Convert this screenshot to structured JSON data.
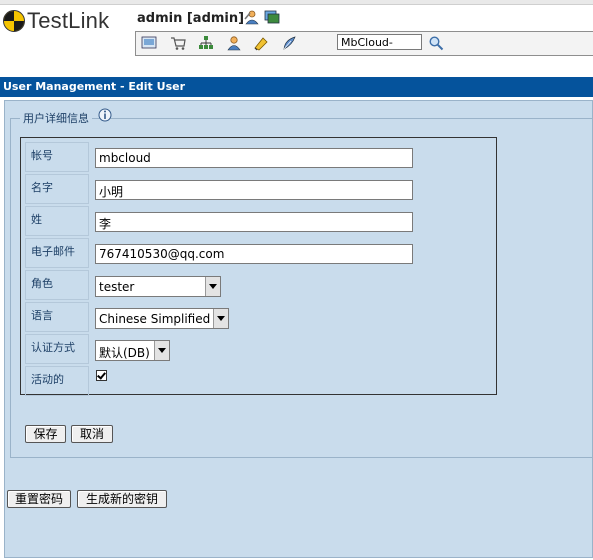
{
  "app": {
    "logo_text": "TestLink",
    "user": "admin [admin]"
  },
  "toolbar": {
    "project_select": "MbCloud-"
  },
  "title_bar": "User Management - Edit User",
  "form": {
    "legend": "用户详细信息",
    "fields": {
      "login": {
        "label": "帐号",
        "value": "mbcloud"
      },
      "first_name": {
        "label": "名字",
        "value": "小明"
      },
      "last_name": {
        "label": "姓",
        "value": "李"
      },
      "email": {
        "label": "电子邮件",
        "value": "767410530@qq.com"
      },
      "role": {
        "label": "角色",
        "value": "tester"
      },
      "locale": {
        "label": "语言",
        "value": "Chinese Simplified"
      },
      "auth": {
        "label": "认证方式",
        "value": "默认(DB)"
      },
      "active": {
        "label": "活动的",
        "checked": true
      }
    },
    "save_label": "保存",
    "cancel_label": "取消"
  },
  "actions": {
    "reset_password": "重置密码",
    "generate_key": "生成新的密钥"
  }
}
